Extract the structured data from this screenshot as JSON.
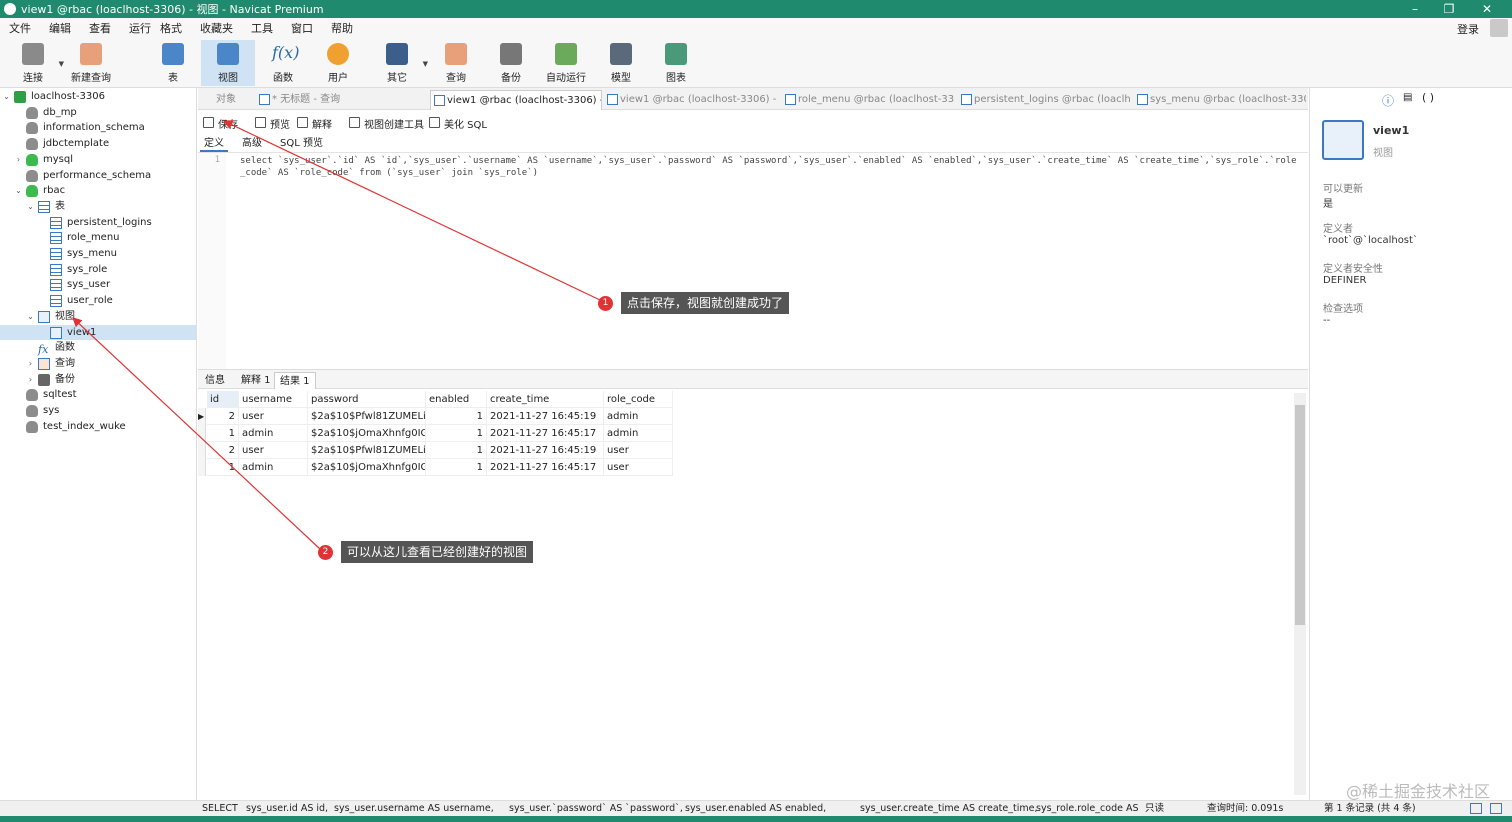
{
  "window": {
    "title": "view1 @rbac (loaclhost-3306) - 视图 - Navicat Premium"
  },
  "menu": [
    "文件",
    "编辑",
    "查看",
    "运行",
    "格式",
    "收藏夹",
    "工具",
    "窗口",
    "帮助"
  ],
  "login_label": "登录",
  "toolbar": [
    {
      "label": "连接",
      "icon": "plug-icon"
    },
    {
      "label": "新建查询",
      "icon": "new-query-icon"
    },
    {
      "label": "表",
      "icon": "table-icon"
    },
    {
      "label": "视图",
      "icon": "view-icon"
    },
    {
      "label": "函数",
      "icon": "function-icon"
    },
    {
      "label": "用户",
      "icon": "user-icon"
    },
    {
      "label": "其它",
      "icon": "tools-icon"
    },
    {
      "label": "查询",
      "icon": "query-icon"
    },
    {
      "label": "备份",
      "icon": "backup-icon"
    },
    {
      "label": "自动运行",
      "icon": "schedule-icon"
    },
    {
      "label": "模型",
      "icon": "model-icon"
    },
    {
      "label": "图表",
      "icon": "chart-icon"
    }
  ],
  "tree": [
    {
      "label": "loaclhost-3306",
      "level": 0,
      "icon": "conn",
      "twisty": "v"
    },
    {
      "label": "db_mp",
      "level": 1,
      "icon": "db"
    },
    {
      "label": "information_schema",
      "level": 1,
      "icon": "db"
    },
    {
      "label": "jdbctemplate",
      "level": 1,
      "icon": "db"
    },
    {
      "label": "mysql",
      "level": 1,
      "icon": "dbg",
      "twisty": ">"
    },
    {
      "label": "performance_schema",
      "level": 1,
      "icon": "db"
    },
    {
      "label": "rbac",
      "level": 1,
      "icon": "dbg",
      "twisty": "v"
    },
    {
      "label": "表",
      "level": 2,
      "icon": "tbl",
      "twisty": "v"
    },
    {
      "label": "persistent_logins",
      "level": 3,
      "icon": "tbl"
    },
    {
      "label": "role_menu",
      "level": 3,
      "icon": "tbl"
    },
    {
      "label": "sys_menu",
      "level": 3,
      "icon": "tbl"
    },
    {
      "label": "sys_role",
      "level": 3,
      "icon": "tbl"
    },
    {
      "label": "sys_user",
      "level": 3,
      "icon": "tbl"
    },
    {
      "label": "user_role",
      "level": 3,
      "icon": "tbl"
    },
    {
      "label": "视图",
      "level": 2,
      "icon": "view",
      "twisty": "v"
    },
    {
      "label": "view1",
      "level": 3,
      "icon": "view",
      "selected": true
    },
    {
      "label": "函数",
      "level": 2,
      "icon": "fx"
    },
    {
      "label": "查询",
      "level": 2,
      "icon": "q",
      "twisty": ">"
    },
    {
      "label": "备份",
      "level": 2,
      "icon": "bk",
      "twisty": ">"
    },
    {
      "label": "sqltest",
      "level": 1,
      "icon": "db"
    },
    {
      "label": "sys",
      "level": 1,
      "icon": "db"
    },
    {
      "label": "test_index_wuke",
      "level": 1,
      "icon": "db"
    }
  ],
  "tabs": [
    {
      "label": "对象"
    },
    {
      "label": "* 无标题 - 查询"
    },
    {
      "label": "view1 @rbac (loaclhost-3306) - ..."
    },
    {
      "label": "view1 @rbac (loaclhost-3306) - ..."
    },
    {
      "label": "role_menu @rbac (loaclhost-33..."
    },
    {
      "label": "persistent_logins @rbac (loaclh..."
    },
    {
      "label": "sys_menu @rbac (loaclhost-330..."
    }
  ],
  "editor_toolbar": [
    "保存",
    "预览",
    "解释",
    "视图创建工具",
    "美化 SQL"
  ],
  "editor_tabs": [
    "定义",
    "高级",
    "SQL 预览"
  ],
  "editor": {
    "line_number": "1",
    "sql": "select `sys_user`.`id` AS `id`,`sys_user`.`username` AS `username`,`sys_user`.`password` AS `password`,`sys_user`.`enabled` AS `enabled`,`sys_user`.`create_time` AS `create_time`,`sys_role`.`role_code` AS `role_code` from (`sys_user` join `sys_role`)"
  },
  "result_tabs": [
    "信息",
    "解释 1",
    "结果 1"
  ],
  "grid": {
    "columns": [
      "id",
      "username",
      "password",
      "enabled",
      "create_time",
      "role_code"
    ],
    "rows": [
      [
        "2",
        "user",
        "$2a$10$Pfwl81ZUMELiDnl",
        "1",
        "2021-11-27 16:45:19",
        "admin"
      ],
      [
        "1",
        "admin",
        "$2a$10$jOmaXhnfg0IGlJ9",
        "1",
        "2021-11-27 16:45:17",
        "admin"
      ],
      [
        "2",
        "user",
        "$2a$10$Pfwl81ZUMELiDnl",
        "1",
        "2021-11-27 16:45:19",
        "user"
      ],
      [
        "1",
        "admin",
        "$2a$10$jOmaXhnfg0IGlJ9",
        "1",
        "2021-11-27 16:45:17",
        "user"
      ]
    ]
  },
  "info_panel": {
    "name": "view1",
    "type": "视图",
    "fields": [
      {
        "label": "可以更新",
        "value": "是"
      },
      {
        "label": "定义者",
        "value": "`root`@`localhost`"
      },
      {
        "label": "定义者安全性",
        "value": "DEFINER"
      },
      {
        "label": "检查选项",
        "value": "--"
      }
    ]
  },
  "statusbar": {
    "s1": "SELECT",
    "s2": "sys_user.id AS id,",
    "s3": "sys_user.username AS username,",
    "s4": "sys_user.`password` AS `password`,",
    "s5": "sys_user.enabled AS enabled,",
    "s6": "sys_user.create_time AS create_time,",
    "s7": "sys_role.role_code AS",
    "s8": "只读",
    "query_time": "查询时间: 0.091s",
    "records": "第 1 条记录 (共 4 条)"
  },
  "annotations": [
    {
      "badge": "1",
      "text": "点击保存，视图就创建成功了"
    },
    {
      "badge": "2",
      "text": "可以从这儿查看已经创建好的视图"
    }
  ],
  "watermark": "@稀土掘金技术社区",
  "colors": {
    "accent": "#1f8a6d",
    "selection": "#cfe3f5",
    "annotation_red": "#e03434"
  }
}
